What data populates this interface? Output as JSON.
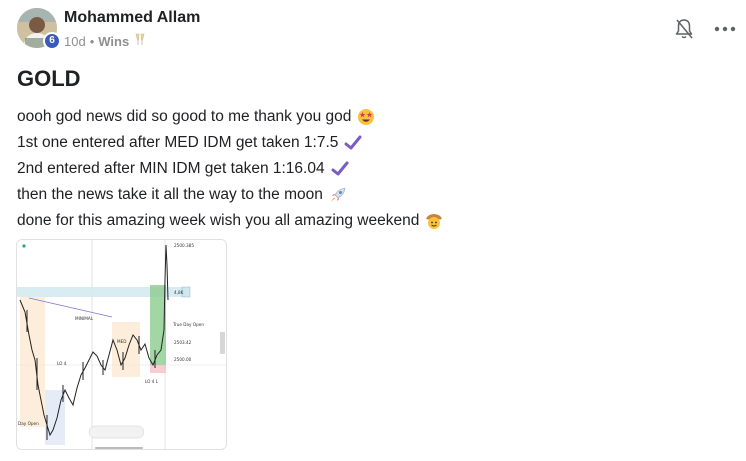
{
  "author": {
    "name": "Mohammed Allam",
    "level": "6",
    "time": "10d",
    "separator": "•",
    "category": "Wins",
    "category_icon": "champagne-emoji"
  },
  "post": {
    "title": "GOLD",
    "lines": [
      {
        "text": "oooh god news did so good to me thank you god",
        "icon": "star-struck-emoji"
      },
      {
        "text": "1st one entered after MED IDM get taken 1:7.5",
        "icon": "check-mark-icon"
      },
      {
        "text": "2nd entered after MIN IDM get taken 1:16.04",
        "icon": "check-mark-icon"
      },
      {
        "text": "then the news take it all the way to the moon",
        "icon": "rocket-emoji"
      },
      {
        "text": "done for this amazing week wish you all amazing weekend",
        "icon": "cowboy-face-emoji"
      }
    ]
  },
  "actions": {
    "notifications_icon": "bell-off-icon",
    "more_icon": "more-horizontal-icon"
  },
  "attachment": {
    "type": "trading-chart-screenshot",
    "labels": [
      "2500.385",
      "4,8K",
      "True Day Open",
      "2503.42",
      "2500.00",
      "MINIMAL",
      "LO 4",
      "LO 4 L",
      "Day Open",
      "MED"
    ]
  },
  "colors": {
    "badge": "#3b5bb8",
    "check": "#7b5cc4",
    "meta": "#909090"
  }
}
